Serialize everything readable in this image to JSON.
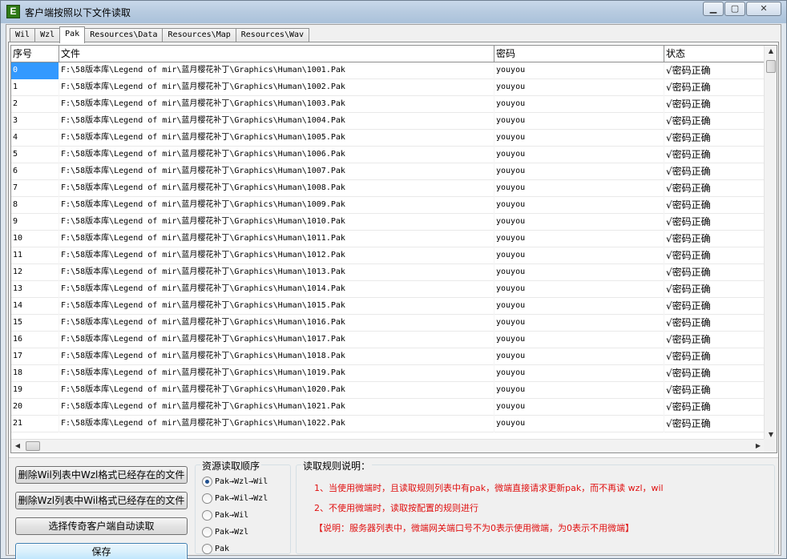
{
  "window": {
    "title": "客户端按照以下文件读取",
    "icon_label": "E"
  },
  "tabs": [
    "Wil",
    "Wzl",
    "Pak",
    "Resources\\Data",
    "Resources\\Map",
    "Resources\\Wav"
  ],
  "active_tab": "Pak",
  "table": {
    "headers": [
      "序号",
      "文件",
      "密码",
      "状态"
    ],
    "rows": [
      [
        "0",
        "F:\\58版本库\\Legend of mir\\蓝月樱花补丁\\Graphics\\Human\\1001.Pak",
        "youyou",
        "√密码正确"
      ],
      [
        "1",
        "F:\\58版本库\\Legend of mir\\蓝月樱花补丁\\Graphics\\Human\\1002.Pak",
        "youyou",
        "√密码正确"
      ],
      [
        "2",
        "F:\\58版本库\\Legend of mir\\蓝月樱花补丁\\Graphics\\Human\\1003.Pak",
        "youyou",
        "√密码正确"
      ],
      [
        "3",
        "F:\\58版本库\\Legend of mir\\蓝月樱花补丁\\Graphics\\Human\\1004.Pak",
        "youyou",
        "√密码正确"
      ],
      [
        "4",
        "F:\\58版本库\\Legend of mir\\蓝月樱花补丁\\Graphics\\Human\\1005.Pak",
        "youyou",
        "√密码正确"
      ],
      [
        "5",
        "F:\\58版本库\\Legend of mir\\蓝月樱花补丁\\Graphics\\Human\\1006.Pak",
        "youyou",
        "√密码正确"
      ],
      [
        "6",
        "F:\\58版本库\\Legend of mir\\蓝月樱花补丁\\Graphics\\Human\\1007.Pak",
        "youyou",
        "√密码正确"
      ],
      [
        "7",
        "F:\\58版本库\\Legend of mir\\蓝月樱花补丁\\Graphics\\Human\\1008.Pak",
        "youyou",
        "√密码正确"
      ],
      [
        "8",
        "F:\\58版本库\\Legend of mir\\蓝月樱花补丁\\Graphics\\Human\\1009.Pak",
        "youyou",
        "√密码正确"
      ],
      [
        "9",
        "F:\\58版本库\\Legend of mir\\蓝月樱花补丁\\Graphics\\Human\\1010.Pak",
        "youyou",
        "√密码正确"
      ],
      [
        "10",
        "F:\\58版本库\\Legend of mir\\蓝月樱花补丁\\Graphics\\Human\\1011.Pak",
        "youyou",
        "√密码正确"
      ],
      [
        "11",
        "F:\\58版本库\\Legend of mir\\蓝月樱花补丁\\Graphics\\Human\\1012.Pak",
        "youyou",
        "√密码正确"
      ],
      [
        "12",
        "F:\\58版本库\\Legend of mir\\蓝月樱花补丁\\Graphics\\Human\\1013.Pak",
        "youyou",
        "√密码正确"
      ],
      [
        "13",
        "F:\\58版本库\\Legend of mir\\蓝月樱花补丁\\Graphics\\Human\\1014.Pak",
        "youyou",
        "√密码正确"
      ],
      [
        "14",
        "F:\\58版本库\\Legend of mir\\蓝月樱花补丁\\Graphics\\Human\\1015.Pak",
        "youyou",
        "√密码正确"
      ],
      [
        "15",
        "F:\\58版本库\\Legend of mir\\蓝月樱花补丁\\Graphics\\Human\\1016.Pak",
        "youyou",
        "√密码正确"
      ],
      [
        "16",
        "F:\\58版本库\\Legend of mir\\蓝月樱花补丁\\Graphics\\Human\\1017.Pak",
        "youyou",
        "√密码正确"
      ],
      [
        "17",
        "F:\\58版本库\\Legend of mir\\蓝月樱花补丁\\Graphics\\Human\\1018.Pak",
        "youyou",
        "√密码正确"
      ],
      [
        "18",
        "F:\\58版本库\\Legend of mir\\蓝月樱花补丁\\Graphics\\Human\\1019.Pak",
        "youyou",
        "√密码正确"
      ],
      [
        "19",
        "F:\\58版本库\\Legend of mir\\蓝月樱花补丁\\Graphics\\Human\\1020.Pak",
        "youyou",
        "√密码正确"
      ],
      [
        "20",
        "F:\\58版本库\\Legend of mir\\蓝月樱花补丁\\Graphics\\Human\\1021.Pak",
        "youyou",
        "√密码正确"
      ],
      [
        "21",
        "F:\\58版本库\\Legend of mir\\蓝月樱花补丁\\Graphics\\Human\\1022.Pak",
        "youyou",
        "√密码正确"
      ]
    ]
  },
  "buttons": {
    "delete_wil": "删除Wil列表中Wzl格式已经存在的文件",
    "delete_wzl": "删除Wzl列表中Wil格式已经存在的文件",
    "choose_client": "选择传奇客户端自动读取",
    "save": "保存"
  },
  "read_order": {
    "legend": "资源读取顺序",
    "options": [
      "Pak→Wzl→Wil",
      "Pak→Wil→Wzl",
      "Pak→Wil",
      "Pak→Wzl",
      "Pak"
    ],
    "selected": "Pak→Wzl→Wil"
  },
  "rules": {
    "legend": "读取规则说明：",
    "line1": "1、当使用微端时，且读取规则列表中有pak，微端直接请求更新pak，而不再读 wzl，wil",
    "line2": "2、不使用微端时，读取按配置的规则进行",
    "line3": "【说明：服务器列表中，微端网关端口号不为0表示使用微端，为0表示不用微端】"
  },
  "colors": {
    "selection": "#3399ff",
    "rule_text": "#e01010",
    "icon_green": "#2f7a16"
  }
}
